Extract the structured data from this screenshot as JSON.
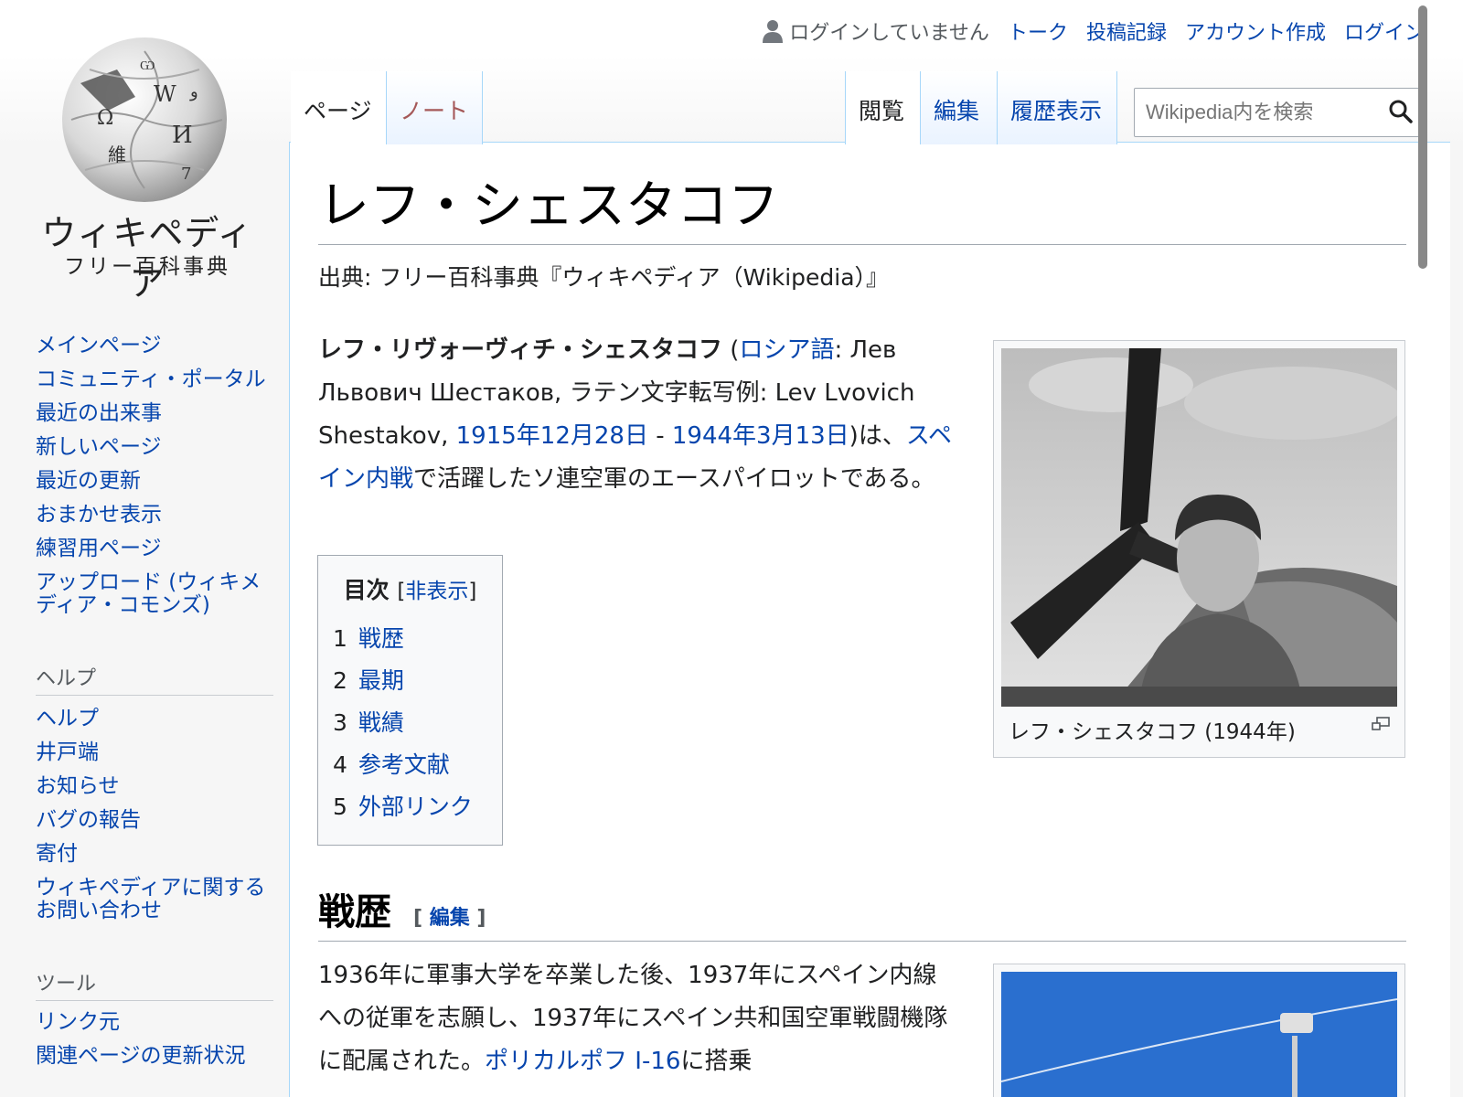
{
  "logo": {
    "wordmark": "ウィキペディア",
    "tagline": "フリー百科事典"
  },
  "personal": {
    "not_logged_in": "ログインしていません",
    "talk": "トーク",
    "contributions": "投稿記録",
    "create_account": "アカウント作成",
    "login": "ログイン"
  },
  "tabs": {
    "page": "ページ",
    "talk": "ノート",
    "read": "閲覧",
    "edit": "編集",
    "history": "履歴表示"
  },
  "search": {
    "placeholder": "Wikipedia内を検索"
  },
  "sidebar": {
    "nav": [
      "メインページ",
      "コミュニティ・ポータル",
      "最近の出来事",
      "新しいページ",
      "最近の更新",
      "おまかせ表示",
      "練習用ページ"
    ],
    "upload_line1": "アップロード (ウィキメ",
    "upload_line2": "ディア・コモンズ)",
    "help_heading": "ヘルプ",
    "help": [
      "ヘルプ",
      "井戸端",
      "お知らせ",
      "バグの報告",
      "寄付"
    ],
    "contact_line1": "ウィキペディアに関する",
    "contact_line2": "お問い合わせ",
    "tools_heading": "ツール",
    "tools": [
      "リンク元",
      "関連ページの更新状況"
    ]
  },
  "article": {
    "title": "レフ・シェスタコフ",
    "from": "出典: フリー百科事典『ウィキペディア（Wikipedia）』",
    "lead_bold": "レフ・リヴォーヴィチ・シェスタコフ",
    "lead_p1": " (",
    "lead_link_lang": "ロシア語",
    "lead_p2": ": Лев Львович Шестаков, ラテン文字転写例: Lev Lvovich Shestakov, ",
    "lead_link_born": "1915年12月28日",
    "lead_p3": " - ",
    "lead_link_died": "1944年3月13日",
    "lead_p4": ")は、",
    "lead_link_war": "スペイン内戦",
    "lead_p5": "で活躍したソ連空軍のエースパイロットである。",
    "caption": "レフ・シェスタコフ (1944年)",
    "section1_title": "戦歴",
    "section1_edit": "編集",
    "section1_p1": "1936年に軍事大学を卒業した後、1937年にスペイン内線への従軍を志願し、1937年にスペイン共和国空軍戦闘機隊に配属された。",
    "section1_link": "ポリカルポフ I-16",
    "section1_p2": "に搭乗"
  },
  "toc": {
    "title": "目次",
    "toggle": "非表示",
    "items": [
      {
        "num": "1",
        "label": "戦歴"
      },
      {
        "num": "2",
        "label": "最期"
      },
      {
        "num": "3",
        "label": "戦績"
      },
      {
        "num": "4",
        "label": "参考文献"
      },
      {
        "num": "5",
        "label": "外部リンク"
      }
    ]
  }
}
